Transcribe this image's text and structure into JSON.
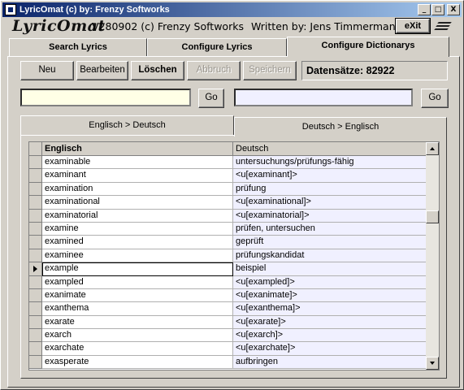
{
  "window": {
    "title": "LyricOmat (c) by: Frenzy Softworks",
    "minimize": "_",
    "maximize": "□",
    "close": "X"
  },
  "header": {
    "logo": "LyricOmat",
    "version": "V280902 (c) Frenzy Softworks",
    "author": "Written by: Jens Timmermann",
    "exit_label": "eXit"
  },
  "tabs": [
    {
      "label": "Search Lyrics",
      "active": false
    },
    {
      "label": "Configure Lyrics",
      "active": false
    },
    {
      "label": "Configure Dictionarys",
      "active": true
    }
  ],
  "toolbar": {
    "new_label": "Neu",
    "edit_label": "Bearbeiten",
    "delete_label": "Löschen",
    "cancel_label": "Abbruch",
    "save_label": "Speichern",
    "count_text": "Datensätze: 82922"
  },
  "search": {
    "left_value": "",
    "left_go": "Go",
    "right_value": "",
    "right_go": "Go"
  },
  "dict_tabs": [
    {
      "label": "Englisch > Deutsch",
      "active": true
    },
    {
      "label": "Deutsch > Englisch",
      "active": false
    }
  ],
  "grid": {
    "columns": [
      "Englisch",
      "Deutsch"
    ],
    "selected_index": 8,
    "rows": [
      {
        "en": "examinable",
        "de": "untersuchungs/prüfungs-fähig"
      },
      {
        "en": "examinant",
        "de": "<u[examinant]>"
      },
      {
        "en": "examination",
        "de": "prüfung"
      },
      {
        "en": "examinational",
        "de": "<u[examinational]>"
      },
      {
        "en": "examinatorial",
        "de": "<u[examinatorial]>"
      },
      {
        "en": "examine",
        "de": "prüfen, untersuchen"
      },
      {
        "en": "examined",
        "de": "geprüft"
      },
      {
        "en": "examinee",
        "de": "prüfungskandidat"
      },
      {
        "en": "example",
        "de": "beispiel"
      },
      {
        "en": "exampled",
        "de": "<u[exampled]>"
      },
      {
        "en": "exanimate",
        "de": "<u[exanimate]>"
      },
      {
        "en": "exanthema",
        "de": "<u[exanthema]>"
      },
      {
        "en": "exarate",
        "de": "<u[exarate]>"
      },
      {
        "en": "exarch",
        "de": "<u[exarch]>"
      },
      {
        "en": "exarchate",
        "de": "<u[exarchate]>"
      },
      {
        "en": "exasperate",
        "de": "aufbringen"
      }
    ]
  }
}
